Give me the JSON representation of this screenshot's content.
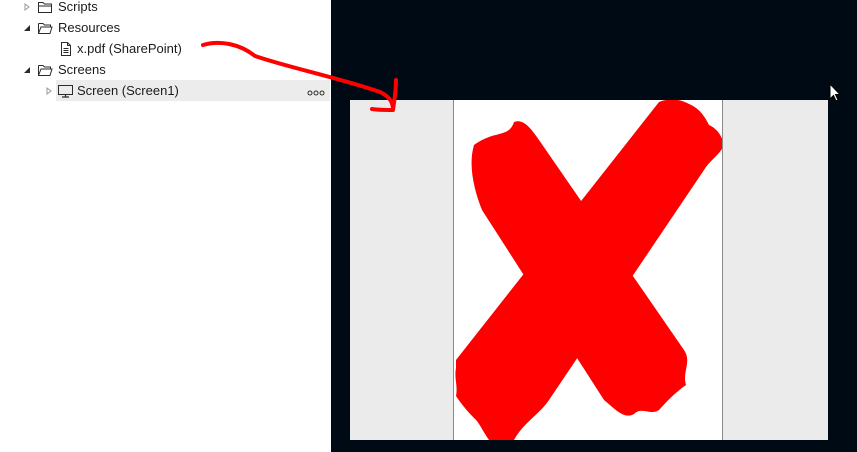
{
  "tree": {
    "items": [
      {
        "label": "Scripts",
        "icon": "folder-icon",
        "expanded": false
      },
      {
        "label": "Resources",
        "icon": "folder-icon",
        "expanded": true
      },
      {
        "label": "x.pdf (SharePoint)",
        "icon": "document-icon"
      },
      {
        "label": "Screens",
        "icon": "folder-icon",
        "expanded": true
      },
      {
        "label": "Screen (Screen1)",
        "icon": "monitor-icon",
        "expanded": false,
        "selected": true
      }
    ]
  },
  "canvas": {
    "background": "#000a14",
    "screen_background": "#ebebeb",
    "pdf_mark_icon": "red-x-icon",
    "pdf_mark_color": "#ff0000"
  },
  "annotation": {
    "color": "#ff0000",
    "icon": "red-arrow-icon"
  },
  "colors": {
    "selected_row": "#ececec",
    "icon_stroke": "#2b2b2b"
  }
}
